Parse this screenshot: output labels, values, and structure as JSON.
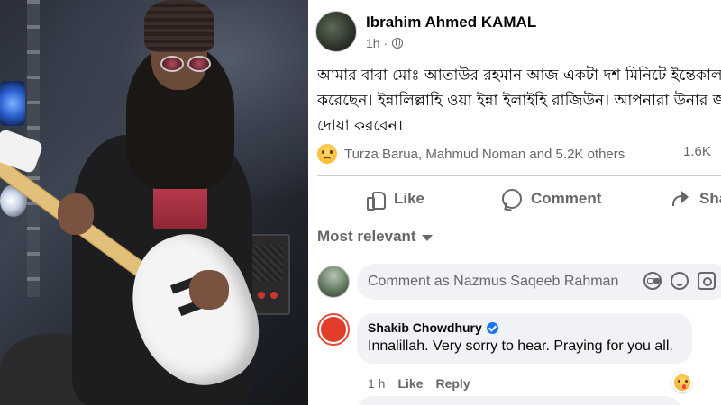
{
  "post": {
    "author": "Ibrahim Ahmed KAMAL",
    "time": "1h ·",
    "body_lines": [
      "আমার বাবা মোঃ আতাউর রহমান আজ একটা দশ মিনিটে ইন্তেকাল",
      "করেছেন। ইন্নালিল্লাহি ওয়া ইন্না ইলাইহি রাজিউন। আপনারা উনার জ",
      "দোয়া করবেন।"
    ],
    "reactions_text": "Turza Barua, Mahmud Noman and 5.2K others",
    "comments_count": "1.6K",
    "actions": {
      "like": "Like",
      "comment": "Comment",
      "share": "Sha"
    }
  },
  "comments_section": {
    "sort_label": "Most relevant",
    "composer_placeholder": "Comment as Nazmus Saqeeb Rahman"
  },
  "comment": {
    "name": "Shakib Chowdhury",
    "text": "Innalillah. Very sorry to hear. Praying for you all.",
    "time": "1 h",
    "like": "Like",
    "reply": "Reply"
  },
  "colors": {
    "fb_blue": "#1877f2",
    "secondary_text": "#65676b",
    "bubble_bg": "#f0f2f5"
  }
}
